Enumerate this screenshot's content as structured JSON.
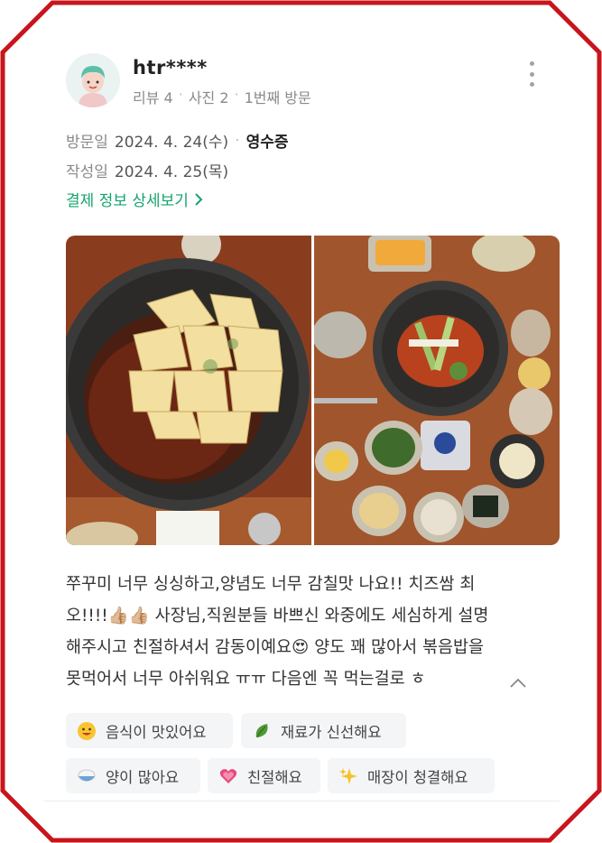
{
  "reviewer": {
    "name": "htr****",
    "meta": [
      "리뷰 4",
      "사진 2",
      "1번째 방문"
    ]
  },
  "visit": {
    "visit_label": "방문일",
    "visit_date": "2024. 4. 24(수)",
    "receipt_label": "영수증",
    "written_label": "작성일",
    "written_date": "2024. 4. 25(목)"
  },
  "payment_link": "결제 정보 상세보기",
  "photos": [
    {
      "name": "cheese-dakgalbi-pan-photo"
    },
    {
      "name": "table-spread-photo"
    }
  ],
  "review": {
    "lines": [
      "쭈꾸미 너무 싱싱하고,양념도 너무 감칠맛 나요!! 치즈쌈 최",
      "오!!!!👍🏼👍🏼 사장님,직원분들 바쁘신 와중에도 세심하게 설명",
      "해주시고 친절하셔서 감동이예요😍 양도 꽤 많아서 볶음밥을",
      "못먹어서 너무 아쉬워요 ㅠㅠ 다음엔 꼭 먹는걸로 ㅎ"
    ]
  },
  "tags": [
    {
      "icon": "smile-emoji-icon",
      "label": "음식이 맛있어요"
    },
    {
      "icon": "leaf-icon",
      "label": "재료가 신선해요"
    },
    {
      "icon": "rice-bowl-icon",
      "label": "양이 많아요"
    },
    {
      "icon": "heart-icon",
      "label": "친절해요"
    },
    {
      "icon": "sparkles-icon",
      "label": "매장이 청결해요"
    }
  ],
  "colors": {
    "frame": "#c8151b",
    "link": "#15a36e"
  }
}
